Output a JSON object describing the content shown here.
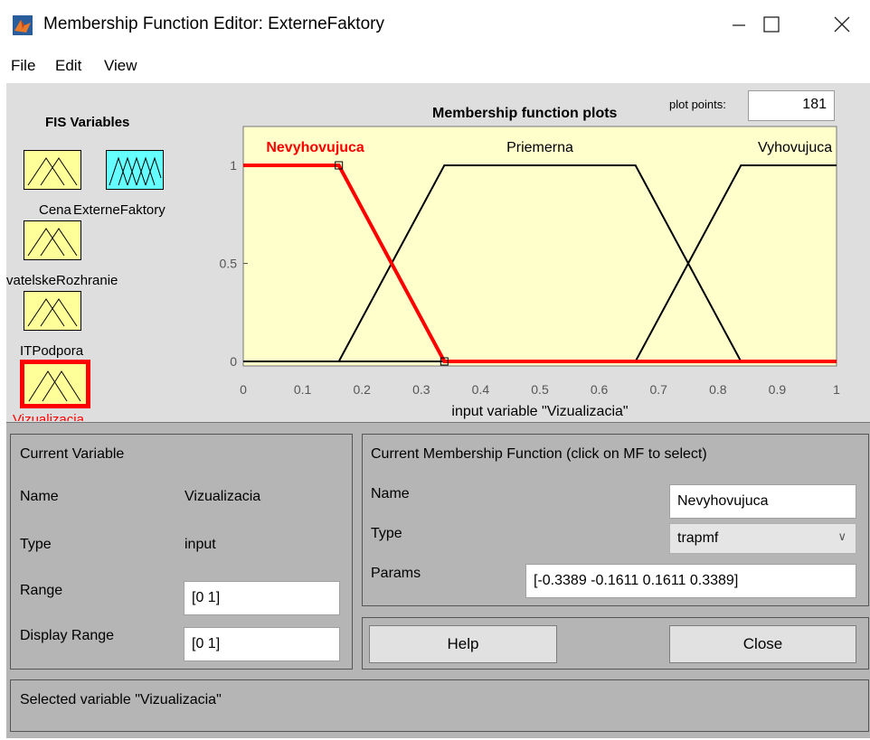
{
  "window": {
    "title": "Membership Function Editor: ExterneFaktory",
    "app_icon": "matlab-icon",
    "minimize_icon": "minimize-icon",
    "maximize_icon": "maximize-icon",
    "close_icon": "close-icon"
  },
  "menu": [
    "File",
    "Edit",
    "View"
  ],
  "fis": {
    "title": "FIS Variables",
    "variables": [
      {
        "label": "Cena",
        "kind": "input",
        "selected": false
      },
      {
        "label": "ExterneFaktory",
        "kind": "output",
        "selected": false
      },
      {
        "label": "vatelskeRozhranie",
        "kind": "input",
        "selected": false
      },
      {
        "label": "ITPodpora",
        "kind": "input",
        "selected": false
      },
      {
        "label": "Vizualizacia",
        "kind": "input",
        "selected": true
      }
    ],
    "colors": {
      "input": "#ffff99",
      "output": "#66ffff",
      "selected_border": "#ff0000"
    }
  },
  "plot": {
    "title": "Membership function plots",
    "plot_points_label": "plot points:",
    "plot_points_value": "181"
  },
  "chart_data": {
    "type": "line",
    "title": "Membership function plots",
    "xlabel": "input variable \"Vizualizacia\"",
    "xlim": [
      0,
      1
    ],
    "ylim": [
      0,
      1.1
    ],
    "xticks": [
      "0",
      "0.1",
      "0.2",
      "0.3",
      "0.4",
      "0.5",
      "0.6",
      "0.7",
      "0.8",
      "0.9",
      "1"
    ],
    "yticks": [
      "0",
      "0.5",
      "1"
    ],
    "background": "#ffffcc",
    "series": [
      {
        "name": "Nevyhovujuca",
        "selected": true,
        "color": "#ff0000",
        "x": [
          0,
          0.1611,
          0.3389,
          1
        ],
        "y": [
          1,
          1,
          0,
          0
        ]
      },
      {
        "name": "Priemerna",
        "selected": false,
        "color": "#000000",
        "x": [
          0,
          0.1611,
          0.3389,
          0.6611,
          0.8389,
          1
        ],
        "y": [
          0,
          0,
          1,
          1,
          0,
          0
        ]
      },
      {
        "name": "Vyhovujuca",
        "selected": false,
        "color": "#000000",
        "x": [
          0,
          0.6611,
          0.8389,
          1
        ],
        "y": [
          0,
          0,
          1,
          1
        ]
      }
    ]
  },
  "current_variable": {
    "title": "Current Variable",
    "name_label": "Name",
    "name_value": "Vizualizacia",
    "type_label": "Type",
    "type_value": "input",
    "range_label": "Range",
    "range_value": "[0 1]",
    "display_range_label": "Display Range",
    "display_range_value": "[0 1]"
  },
  "current_mf": {
    "title": "Current Membership Function (click on MF to select)",
    "name_label": "Name",
    "name_value": "Nevyhovujuca",
    "type_label": "Type",
    "type_value": "trapmf",
    "params_label": "Params",
    "params_value": "[-0.3389 -0.1611 0.1611 0.3389]"
  },
  "buttons": {
    "help": "Help",
    "close": "Close"
  },
  "status": "Selected variable \"Vizualizacia\""
}
